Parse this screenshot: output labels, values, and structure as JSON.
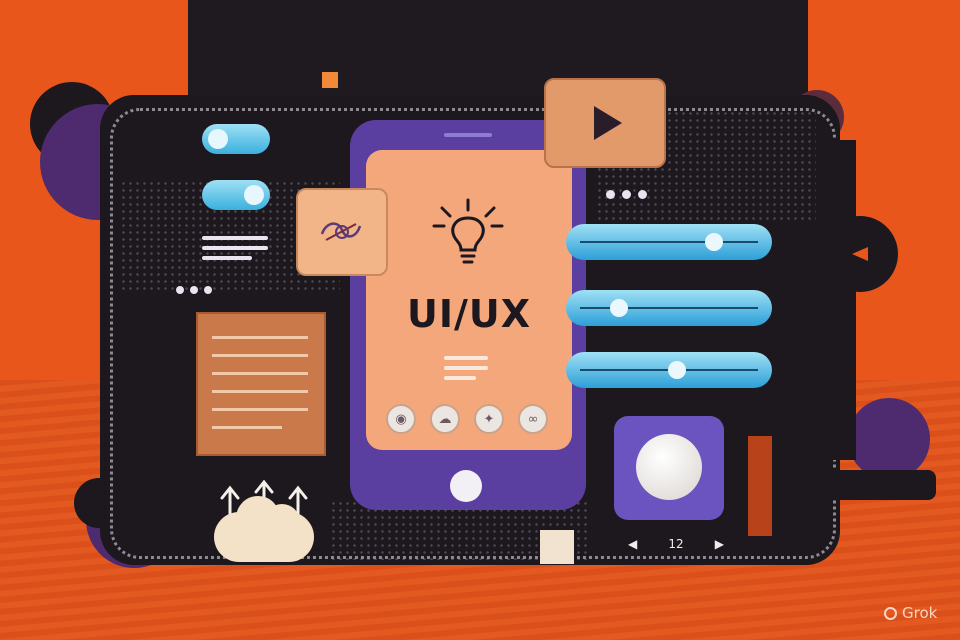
{
  "illustration": {
    "headline": "UI/UX",
    "media_counter": "12",
    "watermark": "Grok"
  },
  "colors": {
    "background": "#e8561c",
    "board": "#1c181d",
    "phone": "#5b3fa0",
    "screen": "#f4a77a",
    "accent_blue": "#3ab0de",
    "accent_purple": "#4e2a6e"
  },
  "controls": {
    "toggles": [
      {
        "name": "toggle-1",
        "state": "on"
      },
      {
        "name": "toggle-2",
        "state": "off"
      }
    ],
    "sliders": [
      {
        "name": "slider-1",
        "level": 0.78
      },
      {
        "name": "slider-2",
        "level": 0.19
      },
      {
        "name": "slider-3",
        "level": 0.55
      }
    ]
  },
  "icons": {
    "idea": "lightbulb-icon",
    "play": "play-icon",
    "upload": "upload-arrows-icon",
    "cloud": "cloud-icon",
    "sketch": "sketch-icon"
  }
}
